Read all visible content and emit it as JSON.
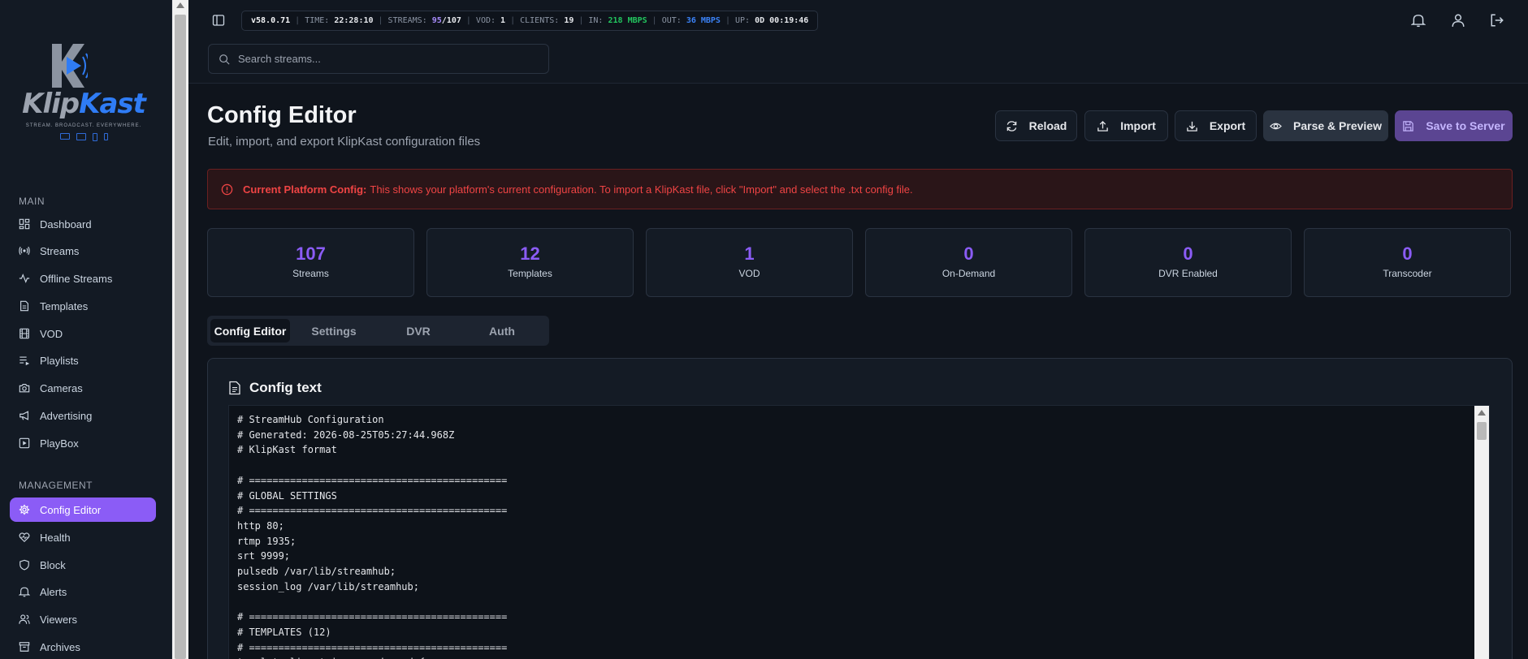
{
  "brand": {
    "name_part1": "Klip",
    "name_part2": "Kast",
    "tagline": "STREAM. BROADCAST. EVERYWHERE."
  },
  "sidebar": {
    "main_label": "MAIN",
    "main_items": [
      {
        "label": "Dashboard",
        "icon": "dashboard-icon"
      },
      {
        "label": "Streams",
        "icon": "broadcast-icon"
      },
      {
        "label": "Offline Streams",
        "icon": "activity-icon"
      },
      {
        "label": "Templates",
        "icon": "file-icon"
      },
      {
        "label": "VOD",
        "icon": "film-icon"
      },
      {
        "label": "Playlists",
        "icon": "list-icon"
      },
      {
        "label": "Cameras",
        "icon": "camera-icon"
      },
      {
        "label": "Advertising",
        "icon": "megaphone-icon"
      },
      {
        "label": "PlayBox",
        "icon": "playbox-icon"
      }
    ],
    "management_label": "MANAGEMENT",
    "management_items": [
      {
        "label": "Config Editor",
        "icon": "gear-icon",
        "active": true
      },
      {
        "label": "Health",
        "icon": "heart-icon"
      },
      {
        "label": "Block",
        "icon": "shield-icon"
      },
      {
        "label": "Alerts",
        "icon": "bell-icon"
      },
      {
        "label": "Viewers",
        "icon": "users-icon"
      },
      {
        "label": "Archives",
        "icon": "archive-icon"
      }
    ]
  },
  "status": {
    "version": "v58.0.71",
    "time_label": "TIME:",
    "time_value": "22:28:10",
    "streams_label": "STREAMS:",
    "streams_active": "95",
    "streams_total": "/107",
    "vod_label": "VOD:",
    "vod_value": "1",
    "clients_label": "CLIENTS:",
    "clients_value": "19",
    "in_label": "IN:",
    "in_value": "218 MBPS",
    "out_label": "OUT:",
    "out_value": "36 MBPS",
    "up_label": "UP:",
    "up_value": "0D 00:19:46"
  },
  "search": {
    "placeholder": "Search streams..."
  },
  "page": {
    "title": "Config Editor",
    "subtitle": "Edit, import, and export KlipKast configuration files"
  },
  "actions": {
    "reload": "Reload",
    "import": "Import",
    "export": "Export",
    "parse_preview": "Parse & Preview",
    "save": "Save to Server"
  },
  "alert": {
    "strong": "Current Platform Config:",
    "text": "This shows your platform's current configuration. To import a KlipKast file, click \"Import\" and select the .txt config file."
  },
  "stats": [
    {
      "value": "107",
      "label": "Streams"
    },
    {
      "value": "12",
      "label": "Templates"
    },
    {
      "value": "1",
      "label": "VOD"
    },
    {
      "value": "0",
      "label": "On-Demand"
    },
    {
      "value": "0",
      "label": "DVR Enabled"
    },
    {
      "value": "0",
      "label": "Transcoder"
    }
  ],
  "tabs": [
    {
      "label": "Config Editor",
      "active": true
    },
    {
      "label": "Settings"
    },
    {
      "label": "DVR"
    },
    {
      "label": "Auth"
    }
  ],
  "config_card": {
    "title": "Config text",
    "text": "# StreamHub Configuration\n# Generated: 2026-08-25T05:27:44.968Z\n# KlipKast format\n\n# ============================================\n# GLOBAL SETTINGS\n# ============================================\nhttp 80;\nrtmp 1935;\nsrt 9999;\npulsedb /var/lib/streamhub;\nsession_log /var/lib/streamhub;\n\n# ============================================\n# TEMPLATES (12)\n# ============================================\ntemplate live_trigger_ondemand {"
  },
  "colors": {
    "accent": "#8b5cf6",
    "background": "#0f141c",
    "alert": "#ef4444",
    "in_rate": "#22c55e",
    "out_rate": "#3b82f6"
  }
}
